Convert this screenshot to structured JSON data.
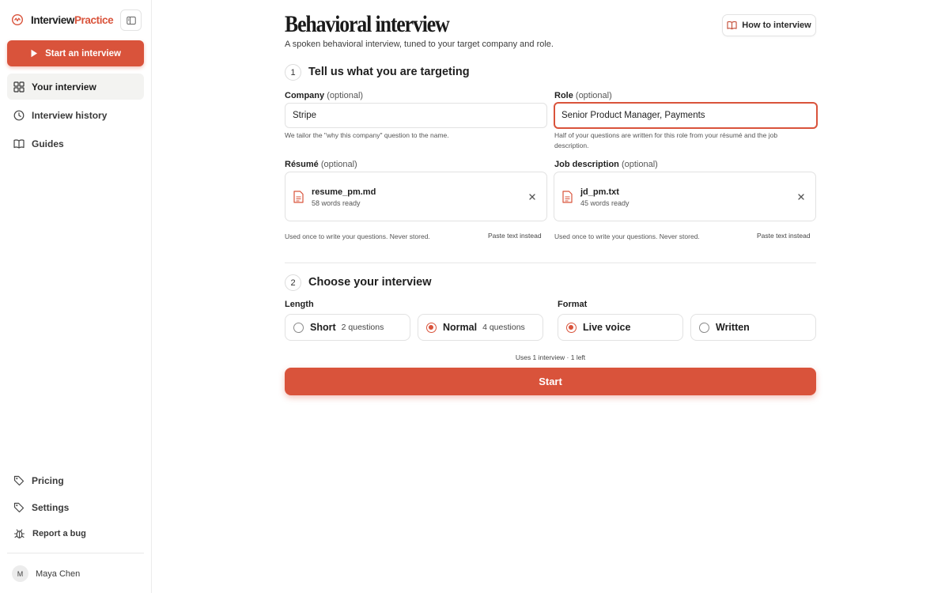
{
  "sidebar": {
    "brand": {
      "part1": "Interview",
      "part2": "Practice"
    },
    "start_button": "Start an interview",
    "nav": [
      {
        "label": "Your interview"
      },
      {
        "label": "Interview history"
      },
      {
        "label": "Guides"
      }
    ],
    "bottom_nav": [
      {
        "label": "Pricing"
      },
      {
        "label": "Settings"
      },
      {
        "label": "Report a bug"
      }
    ],
    "user": {
      "initial": "M",
      "name": "Maya Chen"
    }
  },
  "header": {
    "title": "Behavioral interview",
    "subtitle": "A spoken behavioral interview, tuned to your target company and role.",
    "how_button": "How to interview"
  },
  "step1": {
    "number": "1",
    "title": "Tell us what you are targeting",
    "company": {
      "label": "Company",
      "optional": "(optional)",
      "value": "Stripe",
      "hint": "We tailor the \"why this company\" question to the name."
    },
    "role": {
      "label": "Role",
      "optional": "(optional)",
      "value": "Senior Product Manager, Payments",
      "hint": "Half of your questions are written for this role from your résumé and the job description."
    },
    "resume": {
      "label": "Résumé",
      "optional": "(optional)",
      "file_name": "resume_pm.md",
      "file_meta": "58 words ready",
      "note": "Used once to write your questions. Never stored.",
      "paste": "Paste text instead"
    },
    "job_description": {
      "label": "Job description",
      "optional": "(optional)",
      "file_name": "jd_pm.txt",
      "file_meta": "45 words ready",
      "note": "Used once to write your questions. Never stored.",
      "paste": "Paste text instead"
    }
  },
  "step2": {
    "number": "2",
    "title": "Choose your interview",
    "length_label": "Length",
    "format_label": "Format",
    "length_options": [
      {
        "title": "Short",
        "sub": "2 questions",
        "selected": false
      },
      {
        "title": "Normal",
        "sub": "4 questions",
        "selected": true
      }
    ],
    "format_options": [
      {
        "title": "Live voice",
        "selected": true
      },
      {
        "title": "Written",
        "selected": false
      }
    ]
  },
  "footer": {
    "uses_note": "Uses 1 interview · 1 left",
    "start_button": "Start"
  },
  "colors": {
    "accent": "#d9533b"
  },
  "icons": {
    "brand": "brand-logo-icon",
    "collapse": "sidebar-toggle-icon",
    "play": "play-icon",
    "grid": "grid-icon",
    "clock": "clock-icon",
    "book": "book-icon",
    "tag": "tag-icon",
    "bug": "bug-icon",
    "file": "file-icon",
    "close": "close-icon"
  }
}
